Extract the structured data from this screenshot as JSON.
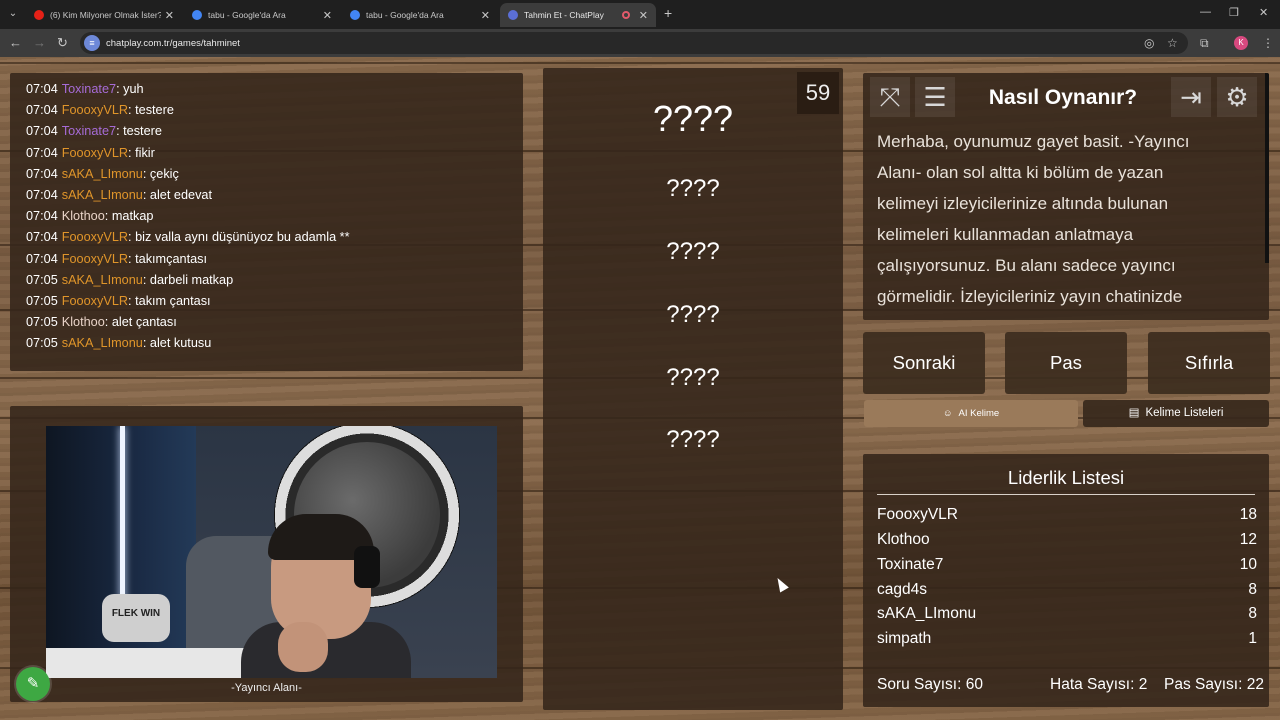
{
  "browser": {
    "tabs": [
      {
        "title": "(6) Kim Milyoner Olmak İster? 1",
        "favicon_color": "#e62117",
        "active": false
      },
      {
        "title": "tabu - Google'da Ara",
        "favicon_color": "#4285f4",
        "active": false
      },
      {
        "title": "tabu - Google'da Ara",
        "favicon_color": "#4285f4",
        "active": false
      },
      {
        "title": "Tahmin Et - ChatPlay",
        "favicon_color": "#5b6fd6",
        "active": true
      }
    ],
    "url": "chatplay.com.tr/games/tahminet",
    "profile_initial": "K"
  },
  "chat": {
    "messages": [
      {
        "time": "07:04",
        "user": "Toxinate7",
        "color": "#a66bd6",
        "text": "yuh"
      },
      {
        "time": "07:04",
        "user": "FoooxyVLR",
        "color": "#e0952a",
        "text": "testere"
      },
      {
        "time": "07:04",
        "user": "Toxinate7",
        "color": "#a66bd6",
        "text": "testere"
      },
      {
        "time": "07:04",
        "user": "FoooxyVLR",
        "color": "#e0952a",
        "text": "fikir"
      },
      {
        "time": "07:04",
        "user": "sAKA_LImonu",
        "color": "#e0952a",
        "text": "çekiç"
      },
      {
        "time": "07:04",
        "user": "sAKA_LImonu",
        "color": "#e0952a",
        "text": "alet edevat"
      },
      {
        "time": "07:04",
        "user": "Klothoo",
        "color": "#e9d4c8",
        "text": "matkap"
      },
      {
        "time": "07:04",
        "user": "FoooxyVLR",
        "color": "#e0952a",
        "text": "biz valla aynı düşünüyoz bu adamla **"
      },
      {
        "time": "07:04",
        "user": "FoooxyVLR",
        "color": "#e0952a",
        "text": "takımçantası"
      },
      {
        "time": "07:05",
        "user": "sAKA_LImonu",
        "color": "#e0952a",
        "text": "darbeli matkap"
      },
      {
        "time": "07:05",
        "user": "FoooxyVLR",
        "color": "#e0952a",
        "text": "takım çantası"
      },
      {
        "time": "07:05",
        "user": "Klothoo",
        "color": "#e9d4c8",
        "text": "alet çantası"
      },
      {
        "time": "07:05",
        "user": "sAKA_LImonu",
        "color": "#e0952a",
        "text": "alet kutusu"
      }
    ]
  },
  "stream": {
    "caption": "-Yayıncı Alanı-",
    "pillow_text": "FLEK WIN"
  },
  "game": {
    "timer": "59",
    "main_word": "????",
    "forbidden_words": [
      "????",
      "????",
      "????",
      "????",
      "????"
    ]
  },
  "help": {
    "title": "Nasıl Oynanır?",
    "text": "Merhaba, oyunumuz gayet basit. -Yayıncı Alanı- olan sol altta ki bölüm de yazan kelimeyi izleyicilerinize altında bulunan kelimeleri kullanmadan anlatmaya çalışıyorsunuz. Bu alanı sadece yayıncı görmelidir. İzleyicileriniz yayın chatinizde"
  },
  "controls": {
    "next": "Sonraki",
    "pass": "Pas",
    "reset": "Sıfırla",
    "ai_word": "AI Kelime",
    "word_lists": "Kelime Listeleri"
  },
  "leaderboard": {
    "title": "Liderlik Listesi",
    "rows": [
      {
        "name": "FoooxyVLR",
        "score": "18"
      },
      {
        "name": "Klothoo",
        "score": "12"
      },
      {
        "name": "Toxinate7",
        "score": "10"
      },
      {
        "name": "cagd4s",
        "score": "8"
      },
      {
        "name": "sAKA_LImonu",
        "score": "8"
      },
      {
        "name": "simpath",
        "score": "1"
      }
    ],
    "questions": "Soru Sayısı: 60",
    "errors": "Hata Sayısı: 2",
    "passes": "Pas Sayısı: 22"
  }
}
